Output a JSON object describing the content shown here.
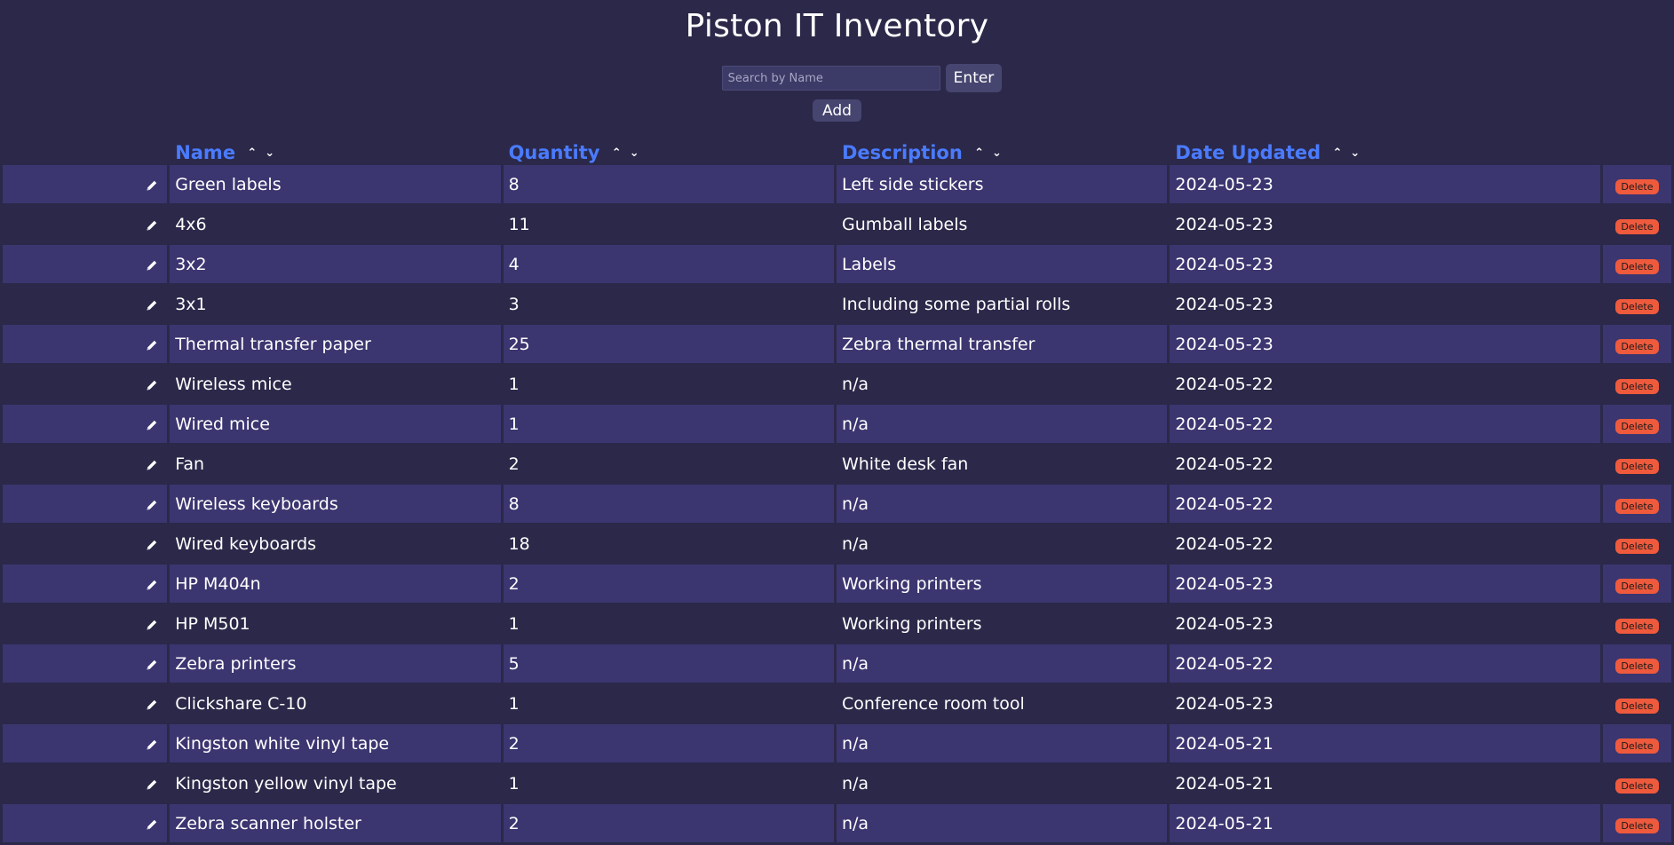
{
  "title": "Piston IT Inventory",
  "search": {
    "placeholder": "Search by Name",
    "value": "",
    "enter_label": "Enter"
  },
  "add_label": "Add",
  "columns": [
    {
      "label": "Name",
      "sort_asc": "⌃",
      "sort_desc": "⌄"
    },
    {
      "label": "Quantity",
      "sort_asc": "⌃",
      "sort_desc": "⌄"
    },
    {
      "label": "Description",
      "sort_asc": "⌃",
      "sort_desc": "⌄"
    },
    {
      "label": "Date Updated",
      "sort_asc": "⌃",
      "sort_desc": "⌄"
    }
  ],
  "delete_label": "Delete",
  "colors": {
    "background": "#2b2849",
    "row_stripe": "#3b3670",
    "header_link": "#4a7bff",
    "delete_button": "#ef5a3d"
  },
  "rows": [
    {
      "name": "Green labels",
      "quantity": "8",
      "description": "Left side stickers",
      "date": "2024-05-23"
    },
    {
      "name": "4x6",
      "quantity": "11",
      "description": "Gumball labels",
      "date": "2024-05-23"
    },
    {
      "name": "3x2",
      "quantity": "4",
      "description": "Labels",
      "date": "2024-05-23"
    },
    {
      "name": "3x1",
      "quantity": "3",
      "description": "Including some partial rolls",
      "date": "2024-05-23"
    },
    {
      "name": "Thermal transfer paper",
      "quantity": "25",
      "description": "Zebra thermal transfer",
      "date": "2024-05-23"
    },
    {
      "name": "Wireless mice",
      "quantity": "1",
      "description": "n/a",
      "date": "2024-05-22"
    },
    {
      "name": "Wired mice",
      "quantity": "1",
      "description": "n/a",
      "date": "2024-05-22"
    },
    {
      "name": "Fan",
      "quantity": "2",
      "description": "White desk fan",
      "date": "2024-05-22"
    },
    {
      "name": "Wireless keyboards",
      "quantity": "8",
      "description": "n/a",
      "date": "2024-05-22"
    },
    {
      "name": "Wired keyboards",
      "quantity": "18",
      "description": "n/a",
      "date": "2024-05-22"
    },
    {
      "name": "HP M404n",
      "quantity": "2",
      "description": "Working printers",
      "date": "2024-05-23"
    },
    {
      "name": "HP M501",
      "quantity": "1",
      "description": "Working printers",
      "date": "2024-05-23"
    },
    {
      "name": "Zebra printers",
      "quantity": "5",
      "description": "n/a",
      "date": "2024-05-22"
    },
    {
      "name": "Clickshare C-10",
      "quantity": "1",
      "description": "Conference room tool",
      "date": "2024-05-23"
    },
    {
      "name": "Kingston white vinyl tape",
      "quantity": "2",
      "description": "n/a",
      "date": "2024-05-21"
    },
    {
      "name": "Kingston yellow vinyl tape",
      "quantity": "1",
      "description": "n/a",
      "date": "2024-05-21"
    },
    {
      "name": "Zebra scanner holster",
      "quantity": "2",
      "description": "n/a",
      "date": "2024-05-21"
    }
  ]
}
